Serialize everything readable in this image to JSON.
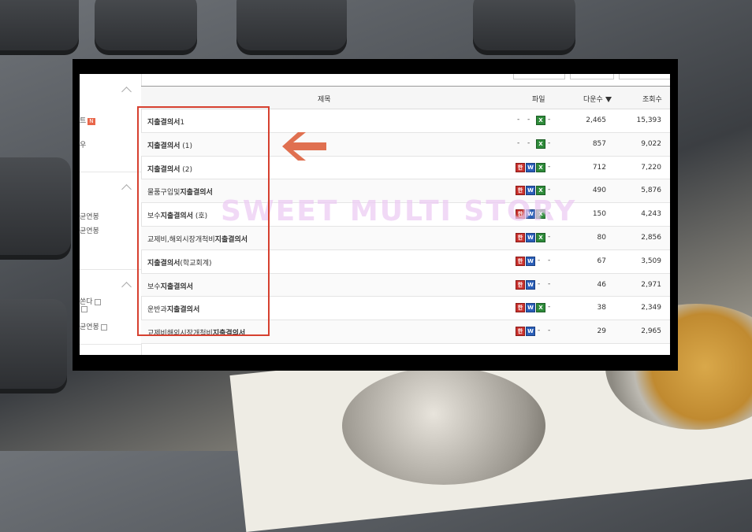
{
  "sidebar": {
    "sec1": {
      "item1": "트",
      "badge": "N",
      "item2": "우"
    },
    "sec2": {
      "item1": "균연봉",
      "item2": "균연봉"
    },
    "sec3": {
      "item1": "쏜다",
      "item2": "균연봉"
    }
  },
  "table": {
    "headers": {
      "title": "제목",
      "file": "파일",
      "downloads": "다운수",
      "views": "조회수"
    },
    "rows": [
      {
        "title_bold": "지출결의서",
        "title_rest": "1",
        "files": [
          "-",
          "-",
          "excel",
          "-"
        ],
        "downloads": "2,465",
        "views": "15,393"
      },
      {
        "title_bold": "지출결의서",
        "title_rest": " (1)",
        "files": [
          "-",
          "-",
          "excel",
          "-"
        ],
        "downloads": "857",
        "views": "9,022"
      },
      {
        "title_bold": "지출결의서",
        "title_rest": " (2)",
        "files": [
          "hwp",
          "word",
          "excel",
          "-"
        ],
        "downloads": "712",
        "views": "7,220"
      },
      {
        "title_pre": "물품구입및",
        "title_bold": "지출결의서",
        "title_rest": "",
        "files": [
          "hwp",
          "word",
          "excel",
          "-"
        ],
        "downloads": "490",
        "views": "5,876"
      },
      {
        "title_pre": "보수",
        "title_bold": "지출결의서",
        "title_rest": " (호)",
        "files": [
          "hwp",
          "word",
          "excel",
          "-"
        ],
        "downloads": "150",
        "views": "4,243"
      },
      {
        "title_pre": "교제비,해외시장개척비",
        "title_bold": "지출결의서",
        "title_rest": "",
        "files": [
          "hwp",
          "word",
          "excel",
          "-"
        ],
        "downloads": "80",
        "views": "2,856"
      },
      {
        "title_bold": "지출결의서",
        "title_rest": "(학교회계)",
        "files": [
          "hwp",
          "word",
          "-",
          "-"
        ],
        "downloads": "67",
        "views": "3,509"
      },
      {
        "title_pre": "보수",
        "title_bold": "지출결의서",
        "title_rest": "",
        "files": [
          "hwp",
          "word",
          "-",
          "-"
        ],
        "downloads": "46",
        "views": "2,971"
      },
      {
        "title_pre": "운반과",
        "title_bold": "지출결의서",
        "title_rest": "",
        "files": [
          "hwp",
          "word",
          "excel",
          "-"
        ],
        "downloads": "38",
        "views": "2,349"
      },
      {
        "title_pre": "교제비해외시장개척비",
        "title_bold": "지출결의서",
        "title_rest": "",
        "files": [
          "hwp",
          "word",
          "-",
          "-"
        ],
        "downloads": "29",
        "views": "2,965"
      }
    ]
  },
  "file_icon_letters": {
    "hwp": "한",
    "word": "W",
    "excel": "X"
  },
  "watermark": "SWEET MULTI STORY",
  "colors": {
    "highlight": "#d6402f",
    "arrow": "#e07050",
    "hwp": "#c9302c",
    "word": "#2b5fb8",
    "excel": "#2e8b3a"
  }
}
